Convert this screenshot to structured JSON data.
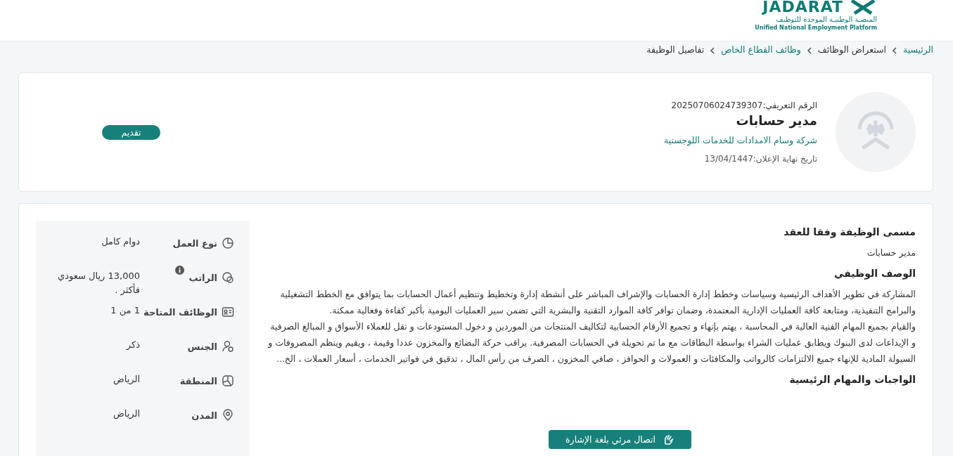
{
  "header": {
    "logo": {
      "name": "JADARAT",
      "subtitle_ar": "المنصـة الوطنيـة الموحدة للتوظيف",
      "subtitle_en": "Unified National Employment Platform"
    }
  },
  "breadcrumb": [
    {
      "label": "الرئيسية",
      "link": true
    },
    {
      "label": "استعراض الوظائف",
      "link": false
    },
    {
      "label": "وظائف القطاع الخاص",
      "link": true
    },
    {
      "label": "تفاصيل الوظيفة",
      "link": false
    }
  ],
  "job_card": {
    "id_label": "الرقم التعريفي:",
    "id_value": "20250706024739307",
    "title": "مدير حسابات",
    "company": "شركة وسام الامدادات للخدمات اللوجستية",
    "deadline_label": "تاريخ نهاية الإعلان:",
    "deadline_value": "13/04/1447",
    "apply_button": "تقديم"
  },
  "details": [
    {
      "kind": "pie",
      "label": "نوع العمل",
      "value": "دوام كامل",
      "info": false
    },
    {
      "kind": "coin",
      "label": "الراتب",
      "value": "13,000 ريال سعودي فأكثر .",
      "info": true
    },
    {
      "kind": "idcard",
      "label": "الوظائف المتاحة",
      "value": "1 من 1",
      "info": false
    },
    {
      "kind": "person",
      "label": "الجنس",
      "value": "ذكر",
      "info": false
    },
    {
      "kind": "map",
      "label": "المنطقة",
      "value": "الرياض",
      "info": false
    },
    {
      "kind": "pin",
      "label": "المدن",
      "value": "الرياض",
      "info": false
    }
  ],
  "sections": [
    {
      "heading": "مسمى الوظيفة وفقا للعقد",
      "paragraphs": [
        "مدير حسابات"
      ]
    },
    {
      "heading": "الوصف الوظيفي",
      "paragraphs": [
        "المشاركة في تطوير الأهداف الرئيسية وسياسات وخطط إدارة الحسابات والإشراف المباشر على أنشطة إدارة وتخطيط وتنظيم أعمال الحسابات بما يتوافق مع الخطط التشغيلية والبرامج التنفيذية، ومتابعة كافة العمليات الإدارية المعتمدة، وضمان توافر كافة الموارد التقنية والبشرية التي تضمن سير العمليات اليومية  بأكبر كفاءة وفعالية ممكنة.",
        "والقيام بجميع المهام الفنية العالية في المحاسبة ، يهتم بإنهاء و تجميع الأرقام الحسابية لتكاليف المنتجات من الموردين  و دخول المستودعات و نقل للعملاء  الأسواق و المبالغ الصرفية و الإيداعات لدى البنوك ويطابق عمليات الشراء بواسطة البطاقات مع ما تم تحويلة في الحسابات المصرفية. يراقب حركة البضائع والمخزون عددا وقيمة ، ويقيم وينظم المصروفات و السيولة المادية للإنهاء جميع الالتزامات كالرواتب والمكافئات و العمولات و الحوافز ، صافي المخزون ، الصرف من رأس المال ، تدقيق في فواتير الخدمات ، أسعار العملات ، الخ..."
      ]
    },
    {
      "heading": "الواجبات والمهام الرئيسية"
    }
  ],
  "sign_language_button": "اتصال مرئي بلغة الإشارة"
}
